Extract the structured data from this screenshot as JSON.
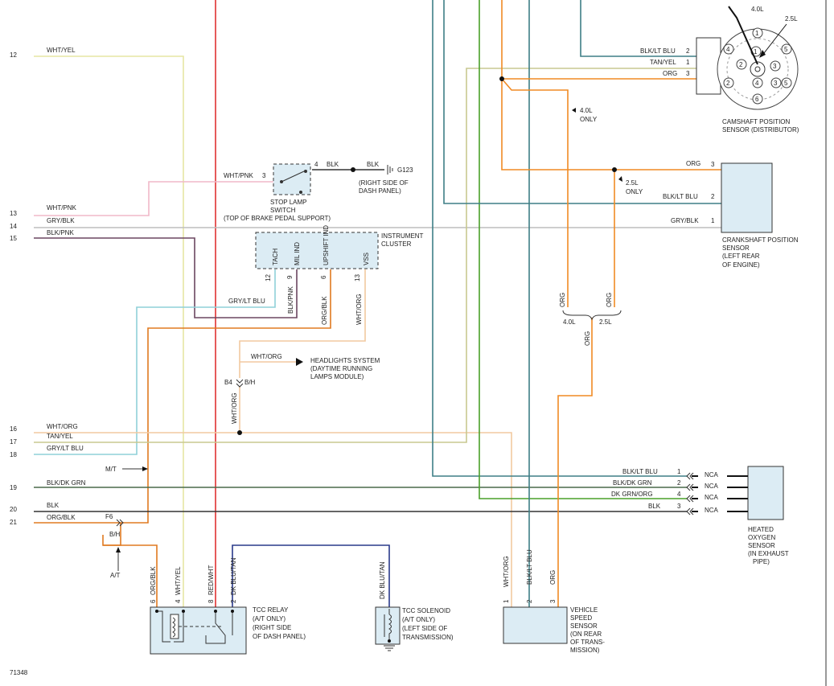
{
  "diagram_id": "71348",
  "wire_colors": {
    "wht_yel": "#e6e6a3",
    "red_wht": "#e03030",
    "wht_pnk": "#f0b8c8",
    "gry_blk": "#bdbdbd",
    "blk_pnk": "#6b4660",
    "gry_lt_blu": "#8fd0d8",
    "org": "#f08a24",
    "wht_org": "#f2c9a0",
    "tan_yel": "#c8c890",
    "blk_dk_grn": "#4a6a4a",
    "blk": "#333333",
    "org_blk": "#e07a20",
    "blk_lt_blu": "#3e7f86",
    "dk_grn_org": "#4aa02a",
    "dk_blu_tan": "#2a3a8a",
    "component_fill": "#dcecf4"
  },
  "left_pins": [
    {
      "num": "12",
      "label": "WHT/YEL"
    },
    {
      "num": "13",
      "label": "WHT/PNK"
    },
    {
      "num": "14",
      "label": "GRY/BLK"
    },
    {
      "num": "15",
      "label": "BLK/PNK"
    },
    {
      "num": "16",
      "label": "WHT/ORG"
    },
    {
      "num": "17",
      "label": "TAN/YEL"
    },
    {
      "num": "18",
      "label": "GRY/LT BLU"
    },
    {
      "num": "19",
      "label": "BLK/DK GRN"
    },
    {
      "num": "20",
      "label": "BLK"
    },
    {
      "num": "21",
      "label": "ORG/BLK"
    }
  ],
  "stop_lamp": {
    "pin_in": "3",
    "pin_out": "4",
    "wire_in": "WHT/PNK",
    "wire_out": "BLK",
    "wire_gnd": "BLK",
    "ground": "G123",
    "ground_note_1": "(RIGHT SIDE OF",
    "ground_note_2": "DASH PANEL)",
    "title_1": "STOP LAMP",
    "title_2": "SWITCH",
    "title_3": "(TOP OF BRAKE PEDAL SUPPORT)"
  },
  "cluster": {
    "title_1": "INSTRUMENT",
    "title_2": "CLUSTER",
    "pins": [
      {
        "name": "TACH",
        "num": "12"
      },
      {
        "name": "MIL IND",
        "num": "9"
      },
      {
        "name": "UPSHIFT IND",
        "num": "6"
      },
      {
        "name": "VSS",
        "num": "13"
      }
    ],
    "wire_tach": "GRY/LT BLU",
    "wire_mil": "BLK/PNK",
    "wire_upshift": "ORG/BLK",
    "wire_vss": "WHT/ORG"
  },
  "headlights": {
    "wire": "WHT/ORG",
    "title_1": "HEADLIGHTS SYSTEM",
    "title_2": "(DAYTIME RUNNING",
    "title_3": "LAMPS MODULE)",
    "conn_a": "B4",
    "conn_b": "B/H",
    "wire_down": "WHT/ORG"
  },
  "camshaft": {
    "wires": [
      {
        "label": "BLK/LT BLU",
        "pin": "2"
      },
      {
        "label": "TAN/YEL",
        "pin": "1"
      },
      {
        "label": "ORG",
        "pin": "3"
      }
    ],
    "engine_a": "4.0L",
    "engine_b": "2.5L",
    "dist_pins": [
      "1",
      "2",
      "3",
      "4",
      "5",
      "2",
      "3",
      "4",
      "5",
      "6",
      "1"
    ],
    "title_1": "CAMSHAFT POSITION",
    "title_2": "SENSOR   (DISTRIBUTOR)",
    "note_engine": "4.0L",
    "note_only": "ONLY"
  },
  "crankshaft": {
    "wires": [
      {
        "label": "ORG",
        "pin": "3"
      },
      {
        "label": "BLK/LT BLU",
        "pin": "2"
      },
      {
        "label": "GRY/BLK",
        "pin": "1"
      }
    ],
    "note_engine": "2.5L",
    "note_only": "ONLY",
    "title_1": "CRANKSHAFT POSITION",
    "title_2": "SENSOR",
    "title_3": "(LEFT REAR",
    "title_4": "OF ENGINE)"
  },
  "org_split": {
    "wire_a": "ORG",
    "wire_b": "ORG",
    "engine_a": "4.0L",
    "engine_b": "2.5L",
    "wire_down": "ORG"
  },
  "oxygen": {
    "wires": [
      {
        "label": "BLK/LT BLU",
        "pin": "1",
        "nca": "NCA"
      },
      {
        "label": "BLK/DK GRN",
        "pin": "2",
        "nca": "NCA"
      },
      {
        "label": "DK GRN/ORG",
        "pin": "4",
        "nca": "NCA"
      },
      {
        "label": "BLK",
        "pin": "3",
        "nca": "NCA"
      }
    ],
    "title_1": "HEATED",
    "title_2": "OXYGEN",
    "title_3": "SENSOR",
    "title_4": "(IN EXHAUST",
    "title_5": "PIPE)"
  },
  "splice_f6": {
    "name": "F6",
    "conn": "B/H",
    "mt": "M/T",
    "at": "A/T"
  },
  "tcc_relay": {
    "pins": [
      {
        "num": "6",
        "wire": "ORG/BLK"
      },
      {
        "num": "4",
        "wire": "WHT/YEL"
      },
      {
        "num": "8",
        "wire": "RED/WHT"
      },
      {
        "num": "2",
        "wire": "DK BLU/TAN"
      }
    ],
    "title_1": "TCC RELAY",
    "title_2": "(A/T ONLY)",
    "title_3": "(RIGHT SIDE",
    "title_4": "OF DASH PANEL)"
  },
  "tcc_solenoid": {
    "wire": "DK BLU/TAN",
    "title_1": "TCC SOLENOID",
    "title_2": "(A/T ONLY)",
    "title_3": "(LEFT SIDE OF",
    "title_4": "TRANSMISSION)"
  },
  "vss": {
    "pins": [
      {
        "num": "1",
        "wire": "WHT/ORG"
      },
      {
        "num": "2",
        "wire": "BLK/LT BLU"
      },
      {
        "num": "3",
        "wire": "ORG"
      }
    ],
    "title_1": "VEHICLE",
    "title_2": "SPEED",
    "title_3": "SENSOR",
    "title_4": "(ON REAR",
    "title_5": "OF TRANS-",
    "title_6": "MISSION)"
  }
}
